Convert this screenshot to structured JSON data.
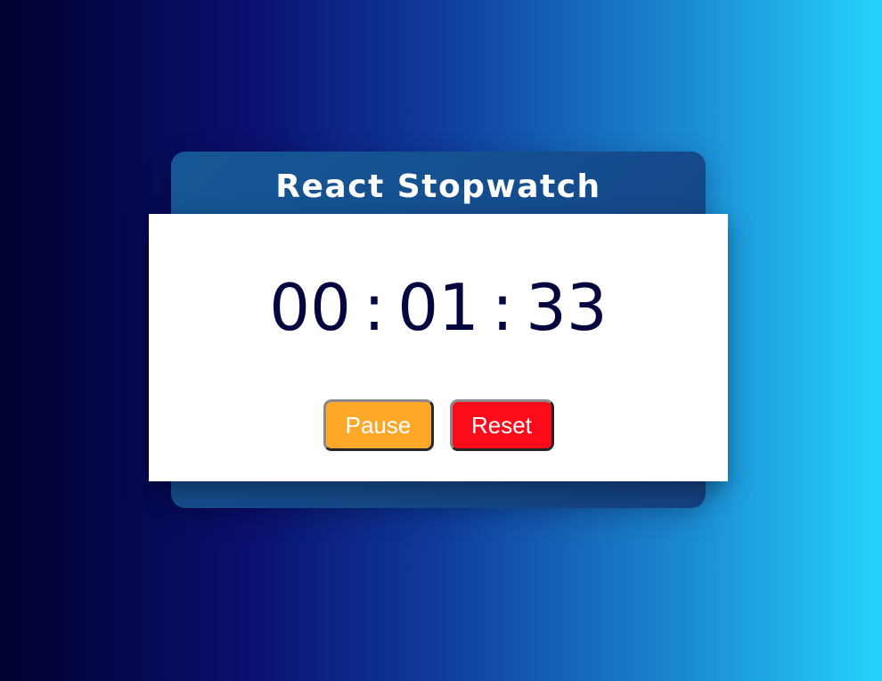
{
  "app": {
    "title": "React Stopwatch"
  },
  "timer": {
    "hours": "00",
    "minutes": "01",
    "seconds": "33",
    "separator": ":"
  },
  "controls": {
    "pause_label": "Pause",
    "reset_label": "Reset"
  },
  "colors": {
    "pause_button": "#fda829",
    "reset_button": "#fe0b1b",
    "time_text": "#05063e",
    "card": "#154c8d"
  }
}
